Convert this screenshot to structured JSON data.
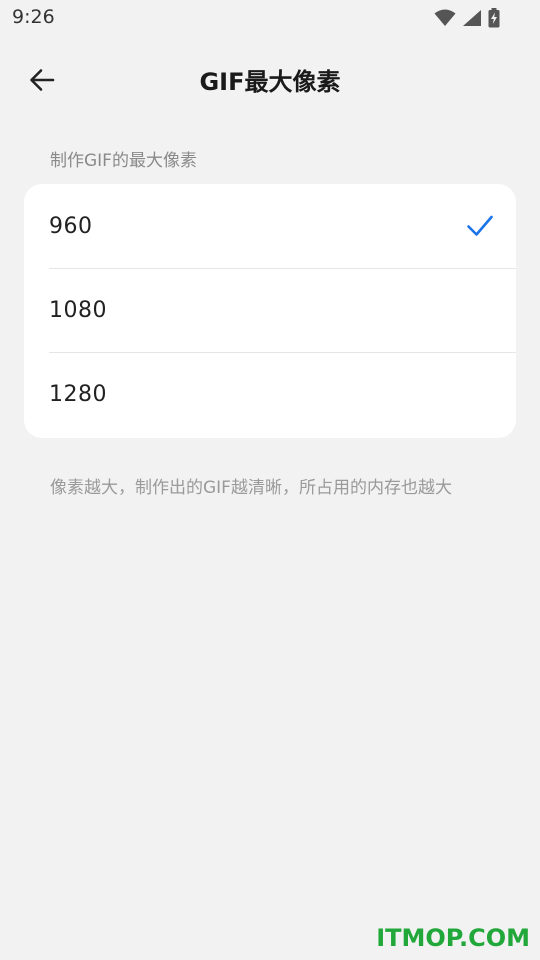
{
  "status_bar": {
    "time": "9:26",
    "icons": [
      "wifi-icon",
      "cellular-signal-icon",
      "battery-charging-icon"
    ]
  },
  "app_bar": {
    "back_icon": "arrow-left-icon",
    "title": "GIF最大像素"
  },
  "section": {
    "label": "制作GIF的最大像素",
    "options": [
      {
        "label": "960",
        "selected": true
      },
      {
        "label": "1080",
        "selected": false
      },
      {
        "label": "1280",
        "selected": false
      }
    ],
    "check_color": "#1a73e8"
  },
  "note": "像素越大，制作出的GIF越清晰，所占用的内存也越大",
  "watermark": "ITMOP.COM",
  "colors": {
    "background": "#f2f2f2",
    "card": "#ffffff",
    "watermark": "#22a83a"
  }
}
